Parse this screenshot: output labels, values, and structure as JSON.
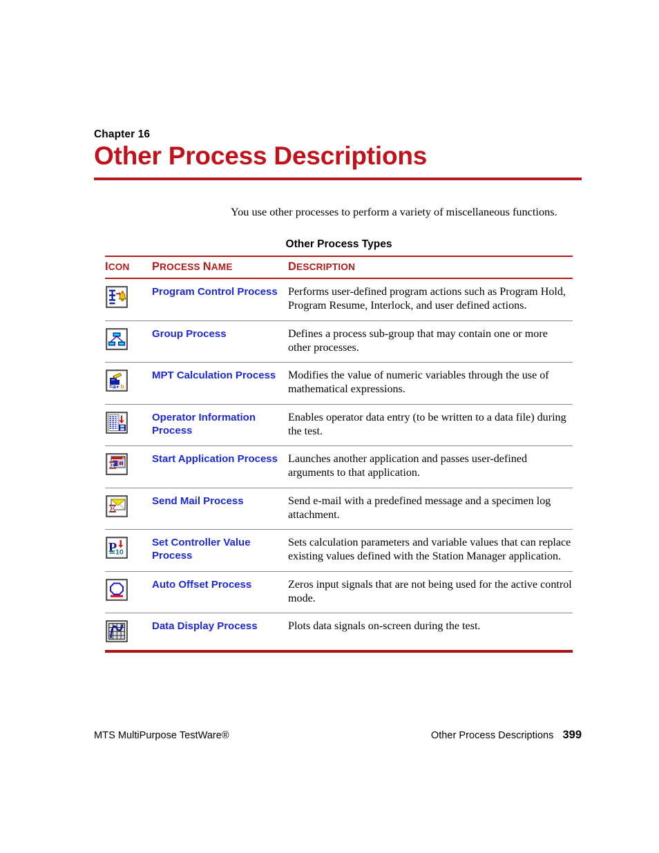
{
  "chapter": {
    "label": "Chapter 16",
    "title": "Other Process Descriptions"
  },
  "intro": "You use other processes to perform a variety of miscellaneous functions.",
  "table": {
    "caption": "Other Process Types",
    "columns": {
      "icon": {
        "cap": "I",
        "rest": "CON"
      },
      "name": {
        "cap": "P",
        "rest": "ROCESS ",
        "cap2": "N",
        "rest2": "AME"
      },
      "description": {
        "cap": "D",
        "rest": "ESCRIPTION"
      }
    },
    "rows": [
      {
        "icon": "program-control-process-icon",
        "name": "Program Control Process",
        "description": "Performs user-defined program actions such as Program Hold, Program Resume, Interlock, and user defined actions."
      },
      {
        "icon": "group-process-icon",
        "name": "Group Process",
        "description": "Defines a process sub-group that may contain one or more other processes."
      },
      {
        "icon": "mpt-calculation-process-icon",
        "name": "MPT Calculation Process",
        "description": "Modifies the value of numeric variables through the use of mathematical expressions."
      },
      {
        "icon": "operator-information-process-icon",
        "name": "Operator Information Process",
        "description": "Enables operator data entry (to be written to a data file) during the test."
      },
      {
        "icon": "start-application-process-icon",
        "name": "Start Application Process",
        "description": "Launches another application and passes user-defined arguments to that application."
      },
      {
        "icon": "send-mail-process-icon",
        "name": "Send Mail Process",
        "description": "Send e-mail with a predefined message and a specimen log attachment."
      },
      {
        "icon": "set-controller-value-process-icon",
        "name": "Set Controller Value Process",
        "description": "Sets calculation parameters and variable values that can replace existing values defined with the Station Manager application."
      },
      {
        "icon": "auto-offset-process-icon",
        "name": "Auto Offset Process",
        "description": "Zeros input signals that are not being used for the active control mode."
      },
      {
        "icon": "data-display-process-icon",
        "name": "Data Display Process",
        "description": "Plots data signals on-screen during the test."
      }
    ]
  },
  "footer": {
    "left": "MTS MultiPurpose TestWare®",
    "right": "Other Process Descriptions",
    "page": "399"
  },
  "colors": {
    "title_red": "#c1121c",
    "rule_red": "#b51a1a",
    "link_blue": "#1c28d8",
    "row_line_gray": "#8a8a8a"
  }
}
